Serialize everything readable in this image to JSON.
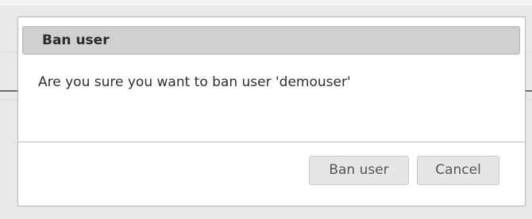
{
  "dialog": {
    "title": "Ban user",
    "message": "Are you sure you want to ban user 'demouser'",
    "buttons": {
      "confirm_label": "Ban user",
      "cancel_label": "Cancel"
    }
  },
  "colors": {
    "header_background": "#d0d0d0",
    "button_background": "#e6e6e6",
    "page_background": "#e9e9e9"
  }
}
